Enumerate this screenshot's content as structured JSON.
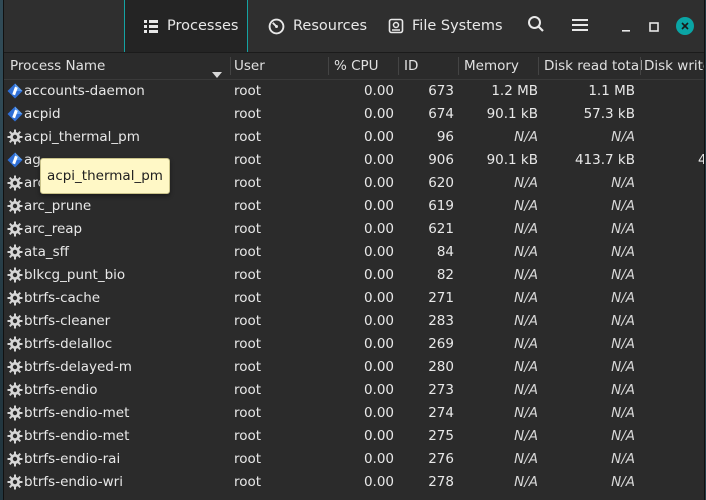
{
  "header": {
    "tabs": [
      {
        "label": "Processes",
        "icon": "list-icon",
        "active": true
      },
      {
        "label": "Resources",
        "icon": "gauge-icon",
        "active": false
      },
      {
        "label": "File Systems",
        "icon": "disk-icon",
        "active": false
      }
    ]
  },
  "columns": {
    "name": "Process Name",
    "user": "User",
    "cpu": "% CPU",
    "id": "ID",
    "memory": "Memory",
    "disk_read": "Disk read total",
    "disk_write": "Disk write"
  },
  "tooltip": {
    "text": "acpi_thermal_pm"
  },
  "processes": [
    {
      "name": "accounts-daemon",
      "icon": "app-icon",
      "user": "root",
      "cpu": "0.00",
      "id": "673",
      "memory": "1.2 MB",
      "disk_read": "1.1 MB",
      "disk_write": ""
    },
    {
      "name": "acpid",
      "icon": "app-icon",
      "user": "root",
      "cpu": "0.00",
      "id": "674",
      "memory": "90.1 kB",
      "disk_read": "57.3 kB",
      "disk_write": ""
    },
    {
      "name": "acpi_thermal_pm",
      "icon": "gear-icon",
      "user": "root",
      "cpu": "0.00",
      "id": "96",
      "memory": "N/A",
      "disk_read": "N/A",
      "disk_write": ""
    },
    {
      "name": "ag",
      "icon": "app-icon",
      "user": "root",
      "cpu": "0.00",
      "id": "906",
      "memory": "90.1 kB",
      "disk_read": "413.7 kB",
      "disk_write": "4"
    },
    {
      "name": "arc",
      "icon": "gear-icon",
      "user": "root",
      "cpu": "0.00",
      "id": "620",
      "memory": "N/A",
      "disk_read": "N/A",
      "disk_write": ""
    },
    {
      "name": "arc_prune",
      "icon": "gear-icon",
      "user": "root",
      "cpu": "0.00",
      "id": "619",
      "memory": "N/A",
      "disk_read": "N/A",
      "disk_write": ""
    },
    {
      "name": "arc_reap",
      "icon": "gear-icon",
      "user": "root",
      "cpu": "0.00",
      "id": "621",
      "memory": "N/A",
      "disk_read": "N/A",
      "disk_write": ""
    },
    {
      "name": "ata_sff",
      "icon": "gear-icon",
      "user": "root",
      "cpu": "0.00",
      "id": "84",
      "memory": "N/A",
      "disk_read": "N/A",
      "disk_write": ""
    },
    {
      "name": "blkcg_punt_bio",
      "icon": "gear-icon",
      "user": "root",
      "cpu": "0.00",
      "id": "82",
      "memory": "N/A",
      "disk_read": "N/A",
      "disk_write": ""
    },
    {
      "name": "btrfs-cache",
      "icon": "gear-icon",
      "user": "root",
      "cpu": "0.00",
      "id": "271",
      "memory": "N/A",
      "disk_read": "N/A",
      "disk_write": ""
    },
    {
      "name": "btrfs-cleaner",
      "icon": "gear-icon",
      "user": "root",
      "cpu": "0.00",
      "id": "283",
      "memory": "N/A",
      "disk_read": "N/A",
      "disk_write": ""
    },
    {
      "name": "btrfs-delalloc",
      "icon": "gear-icon",
      "user": "root",
      "cpu": "0.00",
      "id": "269",
      "memory": "N/A",
      "disk_read": "N/A",
      "disk_write": ""
    },
    {
      "name": "btrfs-delayed-m",
      "icon": "gear-icon",
      "user": "root",
      "cpu": "0.00",
      "id": "280",
      "memory": "N/A",
      "disk_read": "N/A",
      "disk_write": ""
    },
    {
      "name": "btrfs-endio",
      "icon": "gear-icon",
      "user": "root",
      "cpu": "0.00",
      "id": "273",
      "memory": "N/A",
      "disk_read": "N/A",
      "disk_write": ""
    },
    {
      "name": "btrfs-endio-met",
      "icon": "gear-icon",
      "user": "root",
      "cpu": "0.00",
      "id": "274",
      "memory": "N/A",
      "disk_read": "N/A",
      "disk_write": ""
    },
    {
      "name": "btrfs-endio-met",
      "icon": "gear-icon",
      "user": "root",
      "cpu": "0.00",
      "id": "275",
      "memory": "N/A",
      "disk_read": "N/A",
      "disk_write": ""
    },
    {
      "name": "btrfs-endio-rai",
      "icon": "gear-icon",
      "user": "root",
      "cpu": "0.00",
      "id": "276",
      "memory": "N/A",
      "disk_read": "N/A",
      "disk_write": ""
    },
    {
      "name": "btrfs-endio-wri",
      "icon": "gear-icon",
      "user": "root",
      "cpu": "0.00",
      "id": "278",
      "memory": "N/A",
      "disk_read": "N/A",
      "disk_write": ""
    }
  ]
}
